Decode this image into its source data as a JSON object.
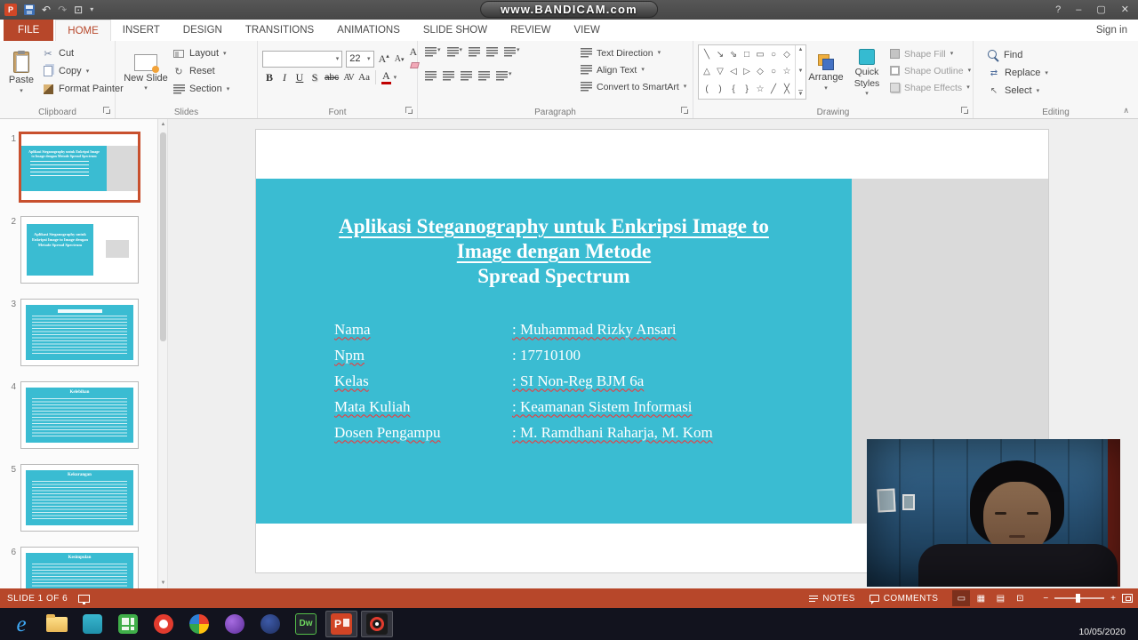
{
  "title_bar": {
    "watermark": "www.BANDICAM.com",
    "qat": [
      {
        "name": "app-logo",
        "glyph": "P"
      },
      {
        "name": "save",
        "glyph": ""
      },
      {
        "name": "undo",
        "glyph": "↶"
      },
      {
        "name": "redo",
        "glyph": "↷"
      },
      {
        "name": "start-slideshow",
        "glyph": "⊡"
      },
      {
        "name": "customize-quick-access",
        "glyph": "▾"
      }
    ],
    "window_controls": [
      {
        "name": "help",
        "glyph": "?"
      },
      {
        "name": "minimize",
        "glyph": "–"
      },
      {
        "name": "maximize",
        "glyph": "▢"
      },
      {
        "name": "close",
        "glyph": "✕"
      }
    ]
  },
  "ribbon": {
    "tabs": [
      {
        "label": "FILE",
        "kind": "file"
      },
      {
        "label": "HOME",
        "kind": "active"
      },
      {
        "label": "INSERT"
      },
      {
        "label": "DESIGN"
      },
      {
        "label": "TRANSITIONS"
      },
      {
        "label": "ANIMATIONS"
      },
      {
        "label": "SLIDE SHOW"
      },
      {
        "label": "REVIEW"
      },
      {
        "label": "VIEW"
      }
    ],
    "sign_in": "Sign in",
    "groups": {
      "clipboard": {
        "label": "Clipboard",
        "paste": "Paste",
        "cut": "Cut",
        "copy": "Copy",
        "format_painter": "Format Painter"
      },
      "slides": {
        "label": "Slides",
        "new_slide": "New Slide",
        "layout": "Layout",
        "reset": "Reset",
        "section": "Section"
      },
      "font": {
        "label": "Font",
        "name": "",
        "size": "22",
        "bold": "B",
        "italic": "I",
        "underline": "U",
        "shadow": "S",
        "strikethrough": "abc",
        "char_spacing": "AV",
        "change_case": "Aa",
        "font_color": "A"
      },
      "paragraph": {
        "label": "Paragraph",
        "text_direction": "Text Direction",
        "align_text": "Align Text",
        "smartart": "Convert to SmartArt"
      },
      "drawing": {
        "label": "Drawing",
        "arrange": "Arrange",
        "quick_styles": "Quick Styles",
        "shape_fill": "Shape Fill",
        "shape_outline": "Shape Outline",
        "shape_effects": "Shape Effects",
        "shape_glyphs": [
          [
            "╲",
            "↘",
            "⇘",
            "□",
            "▭",
            "○",
            "◇"
          ],
          [
            "△",
            "▽",
            "◁",
            "▷",
            "◇",
            "○",
            "☆"
          ],
          [
            "(",
            ")",
            "{",
            "}",
            "☆",
            "╱",
            "╳"
          ]
        ]
      },
      "editing": {
        "label": "Editing",
        "find": "Find",
        "replace": "Replace",
        "select": "Select"
      }
    }
  },
  "thumbnails": [
    {
      "number": "1",
      "layout": "title",
      "selected": true
    },
    {
      "number": "2",
      "layout": "split",
      "title": "Aplikasi Steganography untuk Enkripsi Image to Image dengan Metode Spread Spectrum"
    },
    {
      "number": "3",
      "layout": "content",
      "title": ""
    },
    {
      "number": "4",
      "layout": "content",
      "title": "Kelebihan"
    },
    {
      "number": "5",
      "layout": "content",
      "title": "Kekurangan"
    },
    {
      "number": "6",
      "layout": "content",
      "title": "Kesimpulan"
    }
  ],
  "slide": {
    "title_lines": [
      {
        "text": "Aplikasi Steganography untuk Enkripsi Image to",
        "underline": true
      },
      {
        "text": "Image dengan Metode",
        "underline": true
      },
      {
        "text": "Spread Spectrum",
        "underline": false
      }
    ],
    "info_rows": [
      {
        "label": "Nama",
        "value": ": Muhammad Rizky Ansari",
        "spell": true
      },
      {
        "label": "Npm",
        "value": ": 17710100",
        "spell": false
      },
      {
        "label": "Kelas",
        "value": ": SI Non-Reg BJM 6a",
        "spell": true
      },
      {
        "label": "Mata Kuliah",
        "value": ": Keamanan Sistem Informasi",
        "spell": true
      },
      {
        "label": "Dosen Pengampu",
        "value": ": M. Ramdhani Raharja, M. Kom",
        "spell": true
      }
    ]
  },
  "status_bar": {
    "slide_counter": "SLIDE 1 OF 6",
    "notes": "NOTES",
    "comments": "COMMENTS",
    "view_buttons": [
      {
        "name": "normal-view",
        "glyph": "▭"
      },
      {
        "name": "slide-sorter-view",
        "glyph": "▦"
      },
      {
        "name": "reading-view",
        "glyph": "▤"
      },
      {
        "name": "slideshow-view",
        "glyph": "⊡"
      }
    ],
    "zoom_minus": "−",
    "zoom_plus": "+"
  },
  "taskbar": {
    "date": "10/05/2020",
    "icons": [
      {
        "name": "internet-explorer",
        "text": "e"
      },
      {
        "name": "file-explorer"
      },
      {
        "name": "app-teal"
      },
      {
        "name": "app-green"
      },
      {
        "name": "app-red"
      },
      {
        "name": "photos"
      },
      {
        "name": "app-purple"
      },
      {
        "name": "app-navy"
      },
      {
        "name": "dreamweaver",
        "text": "Dw"
      },
      {
        "name": "powerpoint",
        "text": "P",
        "running": true
      },
      {
        "name": "bandicam",
        "running": true
      }
    ]
  },
  "colors": {
    "accent": "#B7472A",
    "slide_teal": "#3ABCD2",
    "taskbar": "#12131E"
  }
}
